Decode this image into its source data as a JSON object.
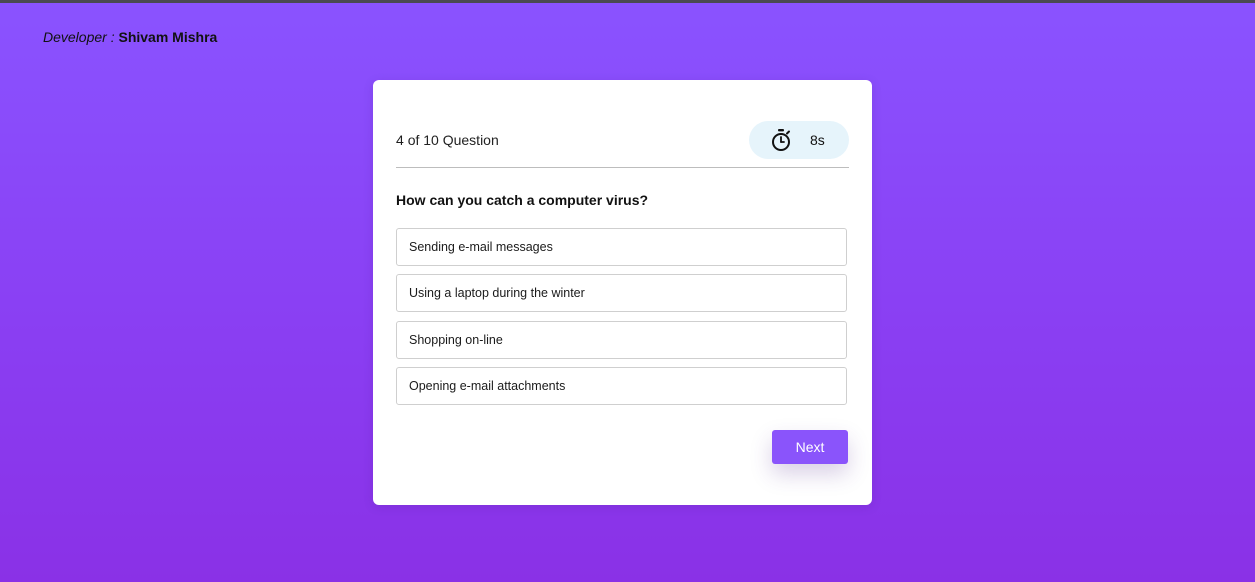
{
  "header": {
    "developer_label": "Developer :",
    "developer_name": "Shivam Mishra"
  },
  "quiz": {
    "current": "4",
    "counter_suffix": "of 10 Question",
    "timer_icon": "stopwatch-icon",
    "timer_value": "8s",
    "question": "How can you catch a computer virus?",
    "options": [
      "Sending e-mail messages",
      "Using a laptop during the winter",
      "Shopping on-line",
      "Opening e-mail attachments"
    ],
    "next_label": "Next"
  },
  "colors": {
    "background_top": "#8a53ff",
    "background_bottom": "#8a31e6",
    "accent": "#8a54fb",
    "timer_bg": "#e6f4fb"
  }
}
